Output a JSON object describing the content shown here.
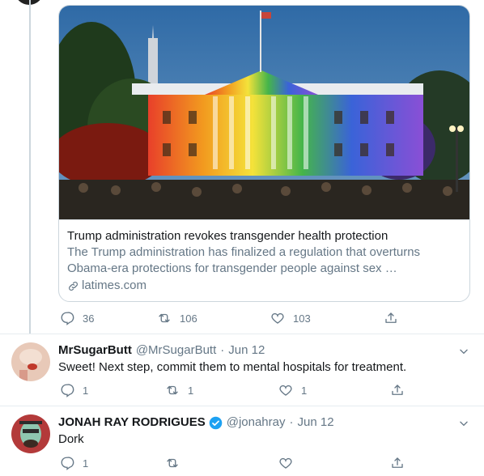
{
  "card": {
    "title": "Trump administration revokes transgender health protection",
    "description": "The Trump administration has finalized a regulation that overturns Obama-era protections for transgender people against sex …",
    "domain": "latimes.com"
  },
  "tweet_actions": {
    "replies": "36",
    "retweets": "106",
    "likes": "103"
  },
  "replies": [
    {
      "name": "MrSugarButt",
      "handle": "@MrSugarButt",
      "dot": "·",
      "date": "Jun 12",
      "text": "Sweet!  Next step, commit them to mental hospitals for treatment.",
      "replies": "1",
      "retweets": "1",
      "likes": "1"
    },
    {
      "name": "JONAH RAY RODRIGUES",
      "handle": "@jonahray",
      "dot": "·",
      "date": "Jun 12",
      "text": "Dork",
      "replies": "1",
      "retweets": "",
      "likes": ""
    }
  ],
  "colors": {
    "text": "#14171a",
    "secondary": "#657786",
    "border": "#ccd6dd",
    "verified": "#1da1f2"
  }
}
